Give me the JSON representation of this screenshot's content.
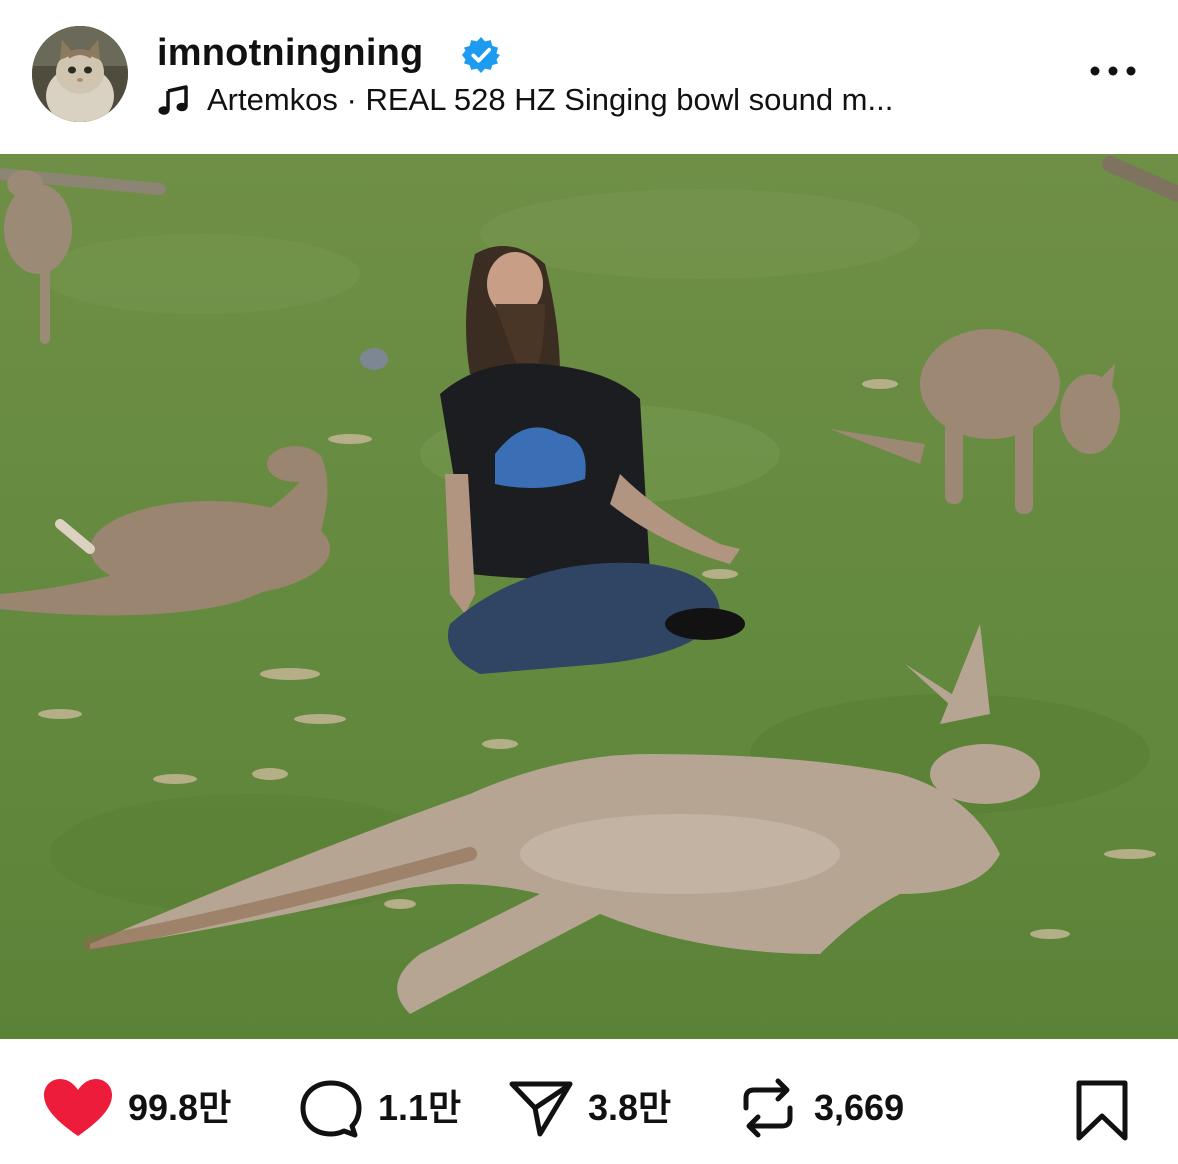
{
  "post": {
    "username": "imnotningning",
    "verified": true,
    "audio": {
      "artist": "Artemkos",
      "separator": " · ",
      "title": "REAL 528 HZ Singing bowl sound m..."
    },
    "media": {
      "type": "video",
      "muted": true
    },
    "actions": {
      "likes": "99.8만",
      "comments": "1.1만",
      "shares": "3.8만",
      "reposts": "3,669"
    }
  },
  "icons": {
    "verified": "verified-badge-icon",
    "music": "music-note-icon",
    "more": "more-options-icon",
    "mute": "speaker-muted-icon",
    "like": "heart-icon",
    "comment": "comment-bubble-icon",
    "share": "paper-plane-icon",
    "repost": "repost-icon",
    "save": "bookmark-icon"
  },
  "colors": {
    "like": "#ee1c3b",
    "verified": "#1d9bf0",
    "text": "#111111"
  }
}
